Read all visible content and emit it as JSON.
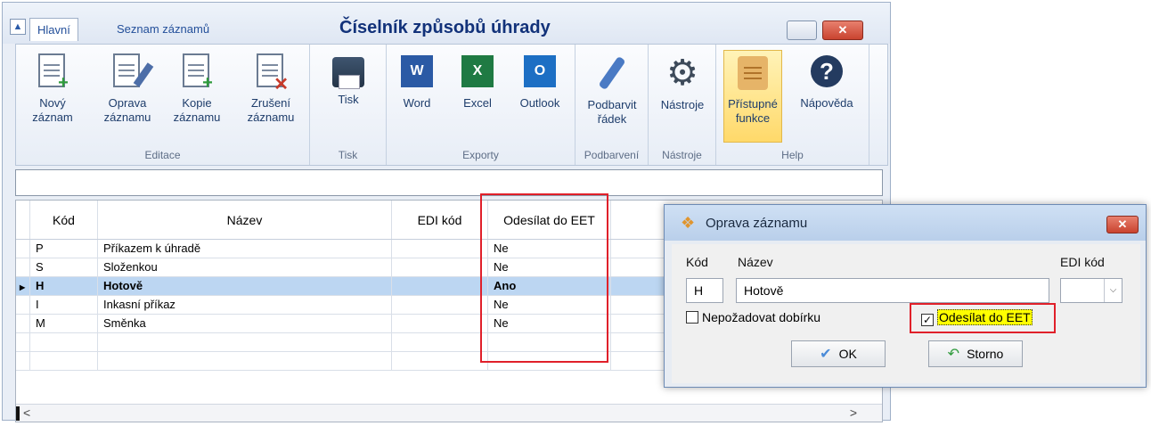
{
  "window": {
    "title": "Číselník způsobů úhrady",
    "tabs": [
      "Hlavní",
      "Seznam záznamů"
    ]
  },
  "ribbon": {
    "groups": [
      {
        "label": "Editace",
        "buttons": [
          "Nový záznam",
          "Oprava záznamu",
          "Kopie záznamu",
          "Zrušení záznamu"
        ]
      },
      {
        "label": "Tisk",
        "buttons": [
          "Tisk"
        ]
      },
      {
        "label": "Exporty",
        "buttons": [
          "Word",
          "Excel",
          "Outlook"
        ]
      },
      {
        "label": "Podbarvení",
        "buttons": [
          "Podbarvit řádek"
        ]
      },
      {
        "label": "Nástroje",
        "buttons": [
          "Nástroje"
        ]
      },
      {
        "label": "Help",
        "buttons": [
          "Přístupné funkce",
          "Nápověda"
        ]
      }
    ]
  },
  "grid": {
    "columns": [
      "Kód",
      "Název",
      "EDI kód",
      "Odesílat do EET"
    ],
    "rows": [
      {
        "kod": "P",
        "nazev": "Příkazem k úhradě",
        "edi": "",
        "eet": "Ne"
      },
      {
        "kod": "S",
        "nazev": "Složenkou",
        "edi": "",
        "eet": "Ne"
      },
      {
        "kod": "H",
        "nazev": "Hotově",
        "edi": "",
        "eet": "Ano"
      },
      {
        "kod": "I",
        "nazev": "Inkasní příkaz",
        "edi": "",
        "eet": "Ne"
      },
      {
        "kod": "M",
        "nazev": "Směnka",
        "edi": "",
        "eet": "Ne"
      }
    ]
  },
  "dialog": {
    "title": "Oprava záznamu",
    "labels": {
      "kod": "Kód",
      "nazev": "Název",
      "edi": "EDI kód"
    },
    "values": {
      "kod": "H",
      "nazev": "Hotově",
      "edi": ""
    },
    "checks": {
      "dobirka": "Nepožadovat dobírku",
      "eet": "Odesílat do EET"
    },
    "buttons": {
      "ok": "OK",
      "storno": "Storno"
    }
  }
}
